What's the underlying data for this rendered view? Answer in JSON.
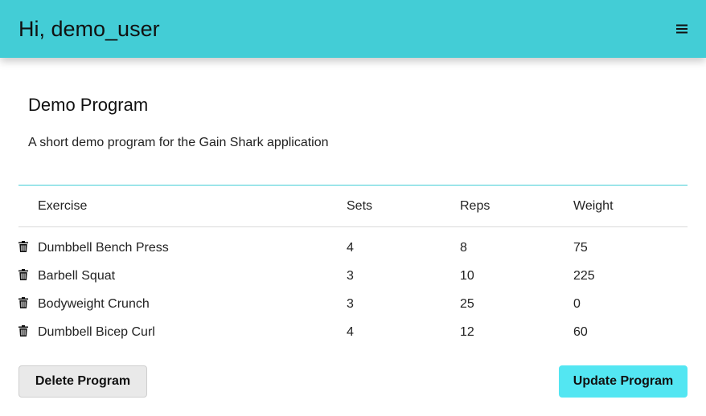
{
  "header": {
    "greeting": "Hi, demo_user",
    "menu_icon": "hamburger-menu-icon",
    "background_color": "#43cdd6"
  },
  "program": {
    "title": "Demo Program",
    "description": "A short demo program for the Gain Shark application"
  },
  "table": {
    "columns": {
      "exercise": "Exercise",
      "sets": "Sets",
      "reps": "Reps",
      "weight": "Weight"
    },
    "delete_icon": "trash-icon",
    "rows": [
      {
        "exercise": "Dumbbell Bench Press",
        "sets": "4",
        "reps": "8",
        "weight": "75"
      },
      {
        "exercise": "Barbell Squat",
        "sets": "3",
        "reps": "10",
        "weight": "225"
      },
      {
        "exercise": "Bodyweight Crunch",
        "sets": "3",
        "reps": "25",
        "weight": "0"
      },
      {
        "exercise": "Dumbbell Bicep Curl",
        "sets": "4",
        "reps": "12",
        "weight": "60"
      }
    ]
  },
  "actions": {
    "delete_label": "Delete Program",
    "update_label": "Update Program",
    "update_color": "#53e6f2",
    "delete_color": "#e9e9e9"
  }
}
